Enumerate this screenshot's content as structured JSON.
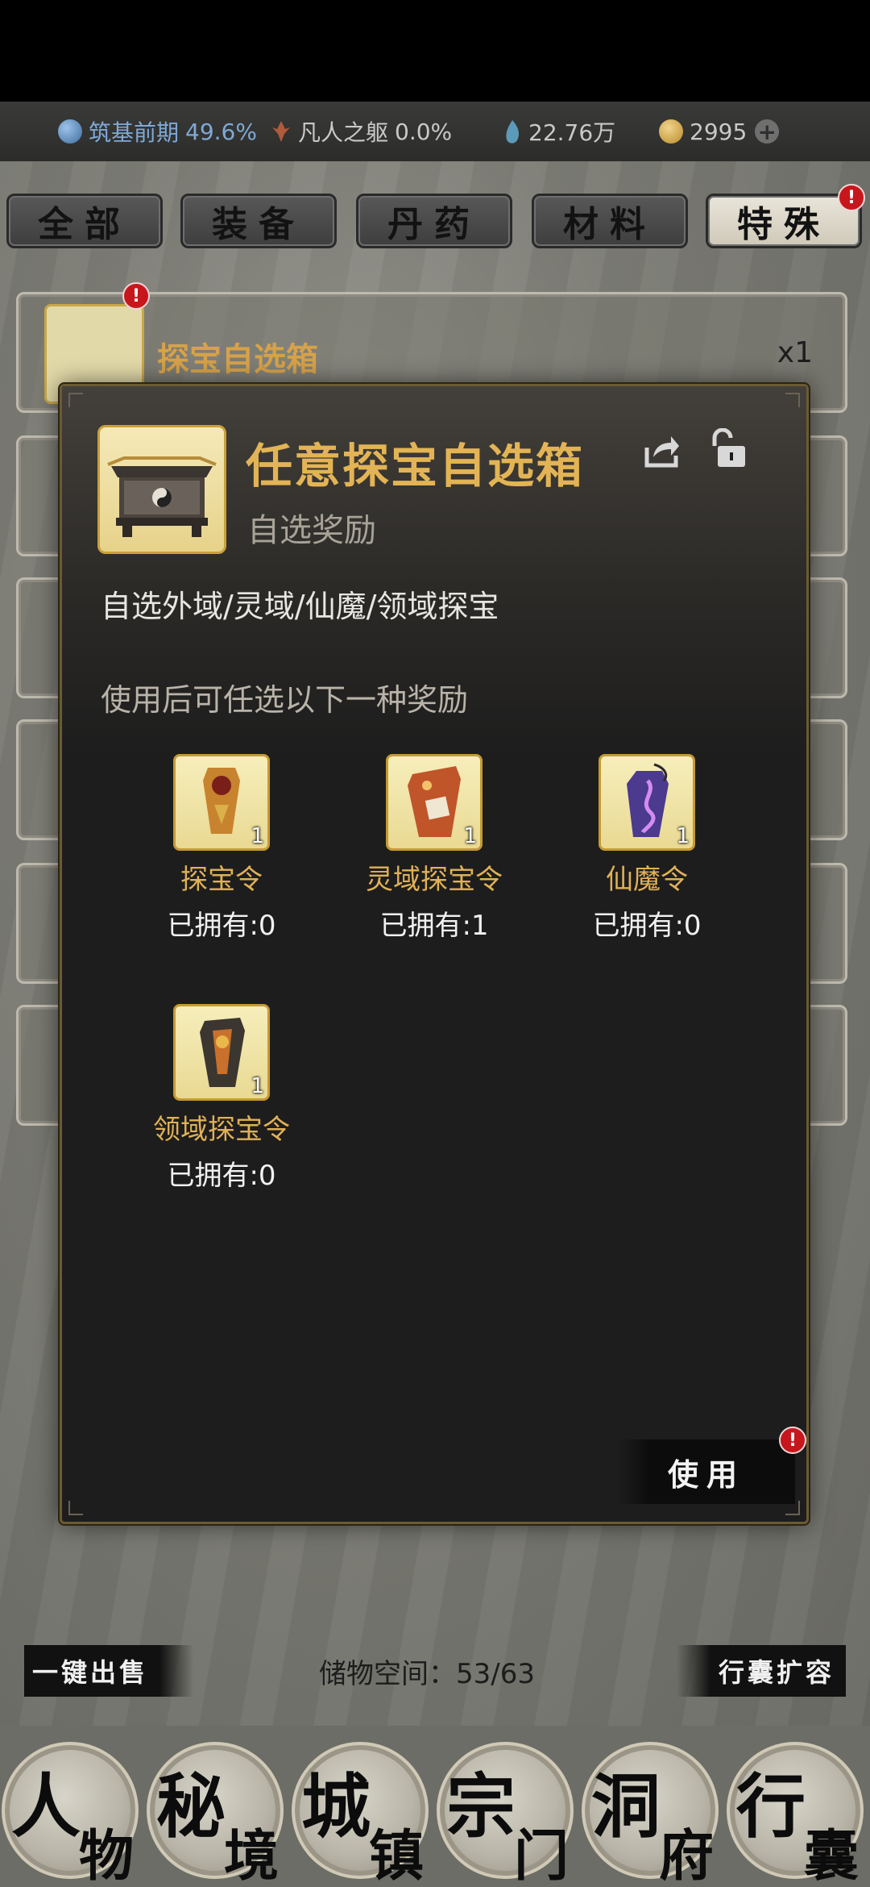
{
  "resources": {
    "cultivation_label": "筑基前期",
    "cultivation_value": "49.6%",
    "body_label": "凡人之躯",
    "body_value": "0.0%",
    "spirit_stones": "22.76万",
    "coins": "2995",
    "icons": [
      "yin-yang-icon",
      "spirit-figure-icon",
      "spirit-crystal-icon",
      "coin-icon",
      "plus-icon"
    ]
  },
  "tabs": [
    {
      "label": "全部",
      "active": false
    },
    {
      "label": "装备",
      "active": false
    },
    {
      "label": "丹药",
      "active": false
    },
    {
      "label": "材料",
      "active": false
    },
    {
      "label": "特殊",
      "active": true
    }
  ],
  "badge": "!",
  "list": [
    {
      "name": "探宝自选箱",
      "count": "x1"
    }
  ],
  "modal": {
    "title": "任意探宝自选箱",
    "subtitle": "自选奖励",
    "description": "自选外域/灵域/仙魔/领域探宝",
    "hint": "使用后可任选以下一种奖励",
    "rewards": [
      {
        "name": "探宝令",
        "qty": "1",
        "owned": "已拥有:0"
      },
      {
        "name": "灵域探宝令",
        "qty": "1",
        "owned": "已拥有:1"
      },
      {
        "name": "仙魔令",
        "qty": "1",
        "owned": "已拥有:0"
      },
      {
        "name": "领域探宝令",
        "qty": "1",
        "owned": "已拥有:0"
      }
    ],
    "use_label": "使用"
  },
  "bottom": {
    "sell_label": "一键出售",
    "storage_text": "储物空间：53/63",
    "expand_label": "行囊扩容"
  },
  "nav": [
    {
      "c1": "人",
      "c2": "物"
    },
    {
      "c1": "秘",
      "c2": "境"
    },
    {
      "c1": "城",
      "c2": "镇"
    },
    {
      "c1": "宗",
      "c2": "门"
    },
    {
      "c1": "洞",
      "c2": "府"
    },
    {
      "c1": "行",
      "c2": "囊"
    }
  ]
}
